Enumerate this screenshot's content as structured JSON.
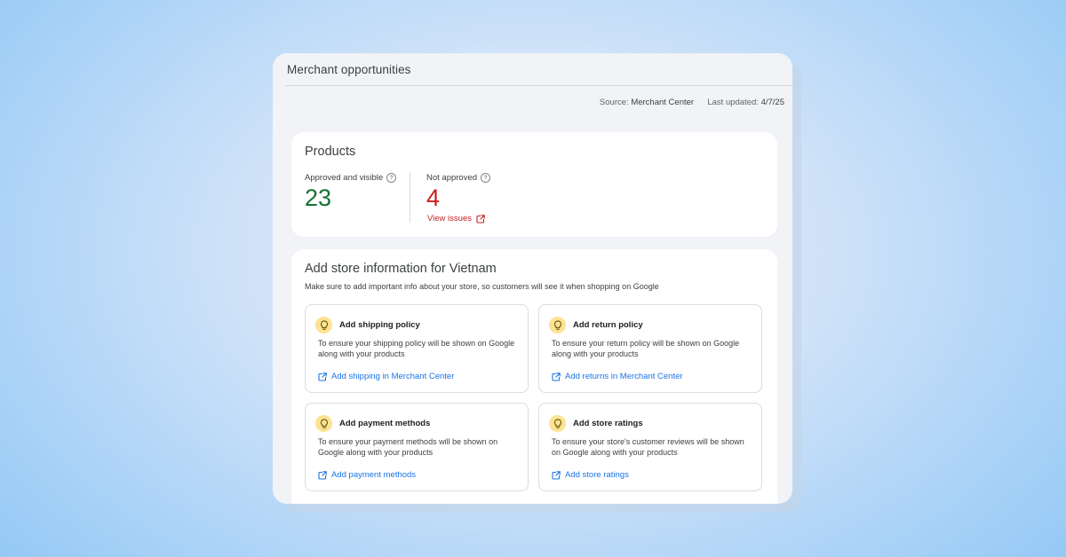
{
  "header": {
    "title": "Merchant opportunities",
    "source_label": "Source:",
    "source_value": "Merchant Center",
    "updated_label": "Last updated:",
    "updated_value": "4/7/25"
  },
  "products": {
    "title": "Products",
    "approved": {
      "label": "Approved and visible",
      "value": "23",
      "color": "#137333"
    },
    "not_approved": {
      "label": "Not approved",
      "value": "4",
      "color": "#c5221f",
      "link": "View issues"
    },
    "help_icon": "?"
  },
  "store_info": {
    "title": "Add store information for Vietnam",
    "subtitle": "Make sure to add important info about your store, so customers will see it when shopping on Google",
    "tips": [
      {
        "icon": "lightbulb-icon",
        "title": "Add shipping policy",
        "body": "To ensure your shipping policy will be shown on Google along with your products",
        "link": "Add shipping in Merchant Center"
      },
      {
        "icon": "lightbulb-icon",
        "title": "Add return policy",
        "body": "To ensure your return policy will be shown on Google along with your products",
        "link": "Add returns in Merchant Center"
      },
      {
        "icon": "lightbulb-icon",
        "title": "Add payment methods",
        "body": "To ensure your payment methods will be shown on Google along with your products",
        "link": "Add payment methods"
      },
      {
        "icon": "lightbulb-icon",
        "title": "Add store ratings",
        "body": "To ensure your store's customer reviews will be shown on Google along with your products",
        "link": "Add store ratings"
      }
    ]
  },
  "colors": {
    "link_blue": "#1a73e8",
    "error_red": "#c5221f",
    "success_green": "#137333",
    "bulb_yellow": "#fde293"
  }
}
